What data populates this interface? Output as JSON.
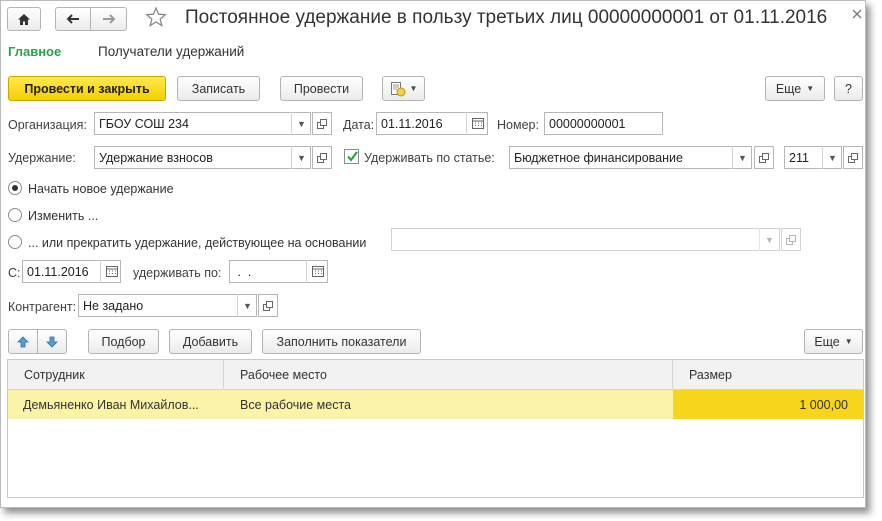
{
  "window": {
    "title": "Постоянное удержание в пользу третьих лиц 00000000001 от 01.11.2016"
  },
  "tabs": {
    "main": "Главное",
    "recipients": "Получатели удержаний"
  },
  "toolbar": {
    "post_close": "Провести и закрыть",
    "save": "Записать",
    "post": "Провести",
    "more": "Еще",
    "help": "?"
  },
  "form": {
    "org_label": "Организация:",
    "org_value": "ГБОУ СОШ 234",
    "date_label": "Дата:",
    "date_value": "01.11.2016",
    "number_label": "Номер:",
    "number_value": "00000000001",
    "deduction_label": "Удержание:",
    "deduction_value": "Удержание взносов",
    "by_article_label": "Удерживать по статье:",
    "by_article_value": "Бюджетное финансирование",
    "article_code": "211",
    "radio_new": "Начать новое удержание",
    "radio_change": "Изменить ...",
    "radio_stop": "... или прекратить удержание, действующее на основании",
    "from_label": "С:",
    "from_value": "01.11.2016",
    "until_label": "удерживать по:",
    "until_value": " .  .",
    "contractor_label": "Контрагент:",
    "contractor_value": "Не задано"
  },
  "table_toolbar": {
    "pick": "Подбор",
    "add": "Добавить",
    "fill": "Заполнить показатели",
    "more": "Еще"
  },
  "table": {
    "columns": [
      "Сотрудник",
      "Рабочее место",
      "Размер"
    ],
    "rows": [
      {
        "employee": "Демьяненко Иван Михайлов...",
        "workplace": "Все рабочие места",
        "amount": "1 000,00"
      }
    ]
  },
  "colors": {
    "accent_yellow": "#f5cf00",
    "tab_green": "#2e9e4b",
    "selected_row": "#fbf3a8",
    "selected_cell": "#f7d51c"
  }
}
